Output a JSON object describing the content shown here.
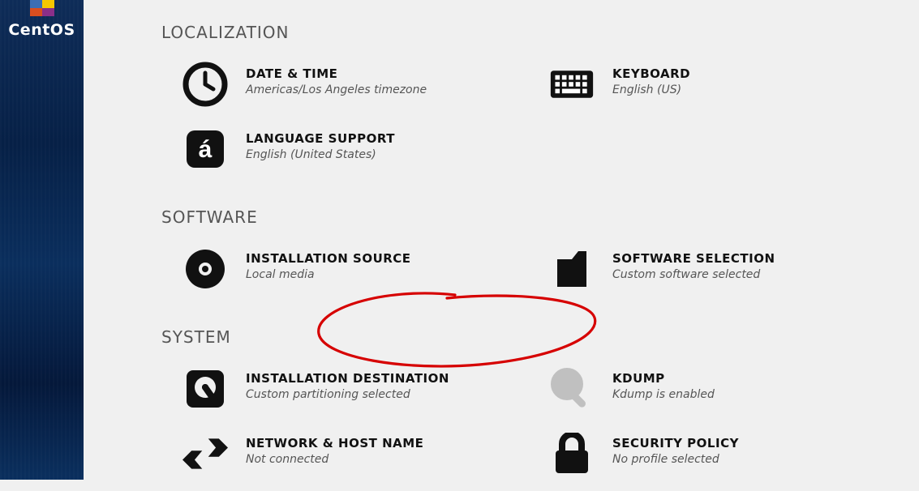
{
  "brand": {
    "name": "CentOS"
  },
  "sections": {
    "localization": {
      "heading": "LOCALIZATION"
    },
    "software": {
      "heading": "SOFTWARE"
    },
    "system": {
      "heading": "SYSTEM"
    }
  },
  "items": {
    "datetime": {
      "title": "DATE & TIME",
      "sub": "Americas/Los Angeles timezone"
    },
    "keyboard": {
      "title": "KEYBOARD",
      "sub": "English (US)"
    },
    "language": {
      "title": "LANGUAGE SUPPORT",
      "sub": "English (United States)"
    },
    "source": {
      "title": "INSTALLATION SOURCE",
      "sub": "Local media"
    },
    "swsel": {
      "title": "SOFTWARE SELECTION",
      "sub": "Custom software selected"
    },
    "dest": {
      "title": "INSTALLATION DESTINATION",
      "sub": "Custom partitioning selected"
    },
    "kdump": {
      "title": "KDUMP",
      "sub": "Kdump is enabled"
    },
    "network": {
      "title": "NETWORK & HOST NAME",
      "sub": "Not connected"
    },
    "security": {
      "title": "SECURITY POLICY",
      "sub": "No profile selected"
    }
  }
}
